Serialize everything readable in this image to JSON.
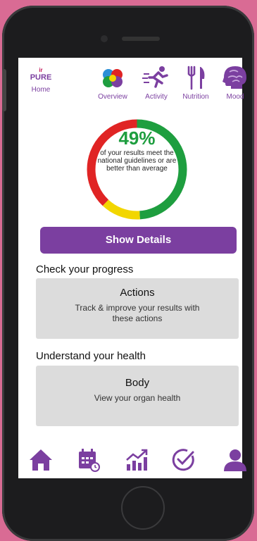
{
  "brand": {
    "logo_prefix": "ir",
    "logo": "PURE",
    "label": "Home"
  },
  "nav": [
    {
      "label": "Overview",
      "icon": "overview-icon"
    },
    {
      "label": "Activity",
      "icon": "running-icon"
    },
    {
      "label": "Nutrition",
      "icon": "fork-knife-icon"
    },
    {
      "label": "Mood",
      "icon": "brain-icon"
    }
  ],
  "score": {
    "percent": "49%",
    "value": 49,
    "description": "of your results meet the national guidelines or are better than average",
    "segments": [
      {
        "status": "green",
        "color": "#1e9e3f"
      },
      {
        "status": "yellow",
        "color": "#f2d600"
      },
      {
        "status": "red",
        "color": "#e02424"
      }
    ]
  },
  "show_details_label": "Show Details",
  "progress": {
    "section_title": "Check your progress",
    "card_title": "Actions",
    "card_desc": "Track & improve your results with these actions"
  },
  "health": {
    "section_title": "Understand your health",
    "card_title": "Body",
    "card_desc": "View your organ health"
  },
  "bottom_nav": [
    "home-icon",
    "calendar-icon",
    "chart-growth-icon",
    "check-circle-icon",
    "user-icon"
  ],
  "colors": {
    "accent": "#7b3fa0",
    "background": "#d96b94"
  }
}
